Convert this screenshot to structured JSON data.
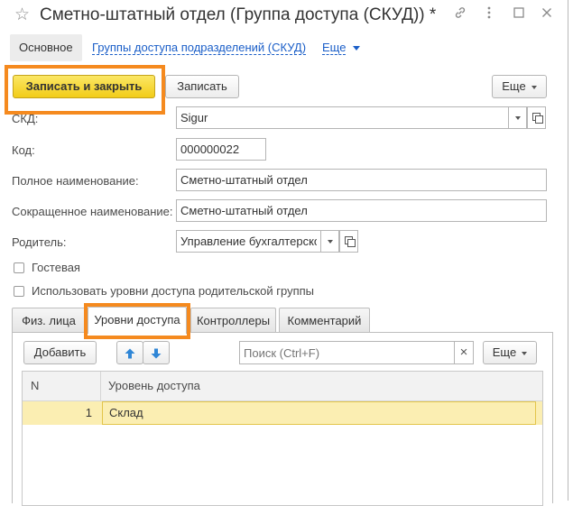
{
  "window": {
    "title": "Сметно-штатный отдел (Группа доступа (СКУД)) *",
    "icons": [
      "star-icon",
      "link-icon",
      "more-vertical-icon",
      "maximize-icon",
      "close-icon"
    ]
  },
  "nav": {
    "main": "Основное",
    "groups_link": "Группы доступа подразделений (СКУД)",
    "more": "Еще"
  },
  "toolbar": {
    "save_close": "Записать и закрыть",
    "save": "Записать",
    "more": "Еще"
  },
  "form": {
    "skd_label": "СКД:",
    "skd_value": "Sigur",
    "code_label": "Код:",
    "code_value": "000000022",
    "full_name_label": "Полное наименование:",
    "full_name_value": "Сметно-штатный отдел",
    "short_name_label": "Сокращенное наименование:",
    "short_name_value": "Сметно-штатный отдел",
    "parent_label": "Родитель:",
    "parent_value": "Управление бухгалтерско",
    "guest_label": "Гостевая",
    "use_parent_levels_label": "Использовать уровни доступа родительской группы"
  },
  "tabs": [
    {
      "label": "Физ. лица"
    },
    {
      "label": "Уровни доступа"
    },
    {
      "label": "Контроллеры"
    },
    {
      "label": "Комментарий"
    }
  ],
  "panel": {
    "add": "Добавить",
    "search_placeholder": "Поиск (Ctrl+F)",
    "clear": "×",
    "more": "Еще"
  },
  "table": {
    "columns": [
      "N",
      "Уровень доступа"
    ],
    "rows": [
      {
        "n": "1",
        "level": "Склад"
      }
    ]
  },
  "colors": {
    "accent_link": "#1a5ec8",
    "primary_button": "#f2cc18",
    "highlight_frame": "#f58a1f",
    "selected_row": "#fbeeb2",
    "move_arrow": "#2f86d6"
  }
}
